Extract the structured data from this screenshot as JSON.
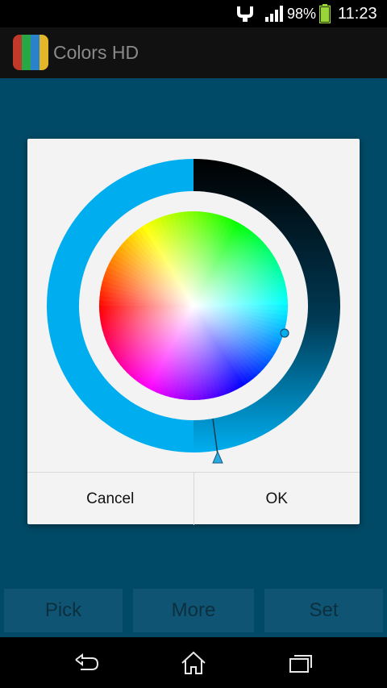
{
  "status_bar": {
    "battery_percent": "98%",
    "time": "11:23",
    "icons": [
      "usb-debug-icon",
      "signal-icon",
      "battery-icon"
    ]
  },
  "app": {
    "title": "Colors HD",
    "icon": "colors-hd-app-icon"
  },
  "dialog": {
    "cancel_label": "Cancel",
    "ok_label": "OK",
    "colors": {
      "selected": "#00aeef",
      "dark_end": "#000000",
      "ring_background": "#f3f3f3"
    }
  },
  "bottom_bar": {
    "pick_label": "Pick",
    "more_label": "More",
    "set_label": "Set"
  },
  "nav_bar": {
    "icons": [
      "back-icon",
      "home-icon",
      "recent-apps-icon"
    ]
  }
}
